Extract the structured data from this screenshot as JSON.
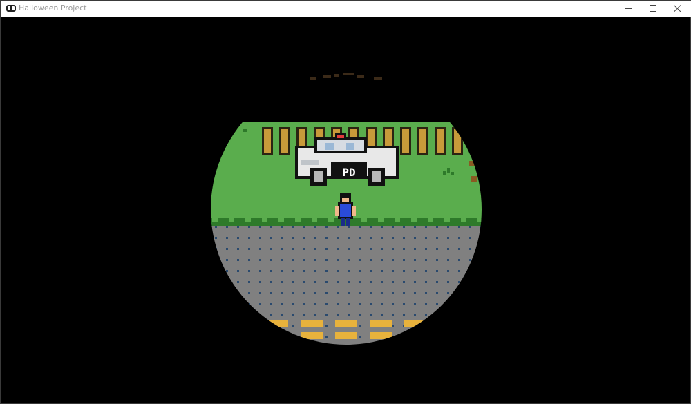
{
  "window": {
    "title": "Halloween Project",
    "app_icon": "gamepad-icon",
    "controls": [
      "minimize-icon",
      "maximize-icon",
      "close-icon"
    ]
  },
  "scene": {
    "vehicle_label": "PD",
    "colors": {
      "grass": "#5aad4d",
      "grass_dark": "#2e7a2a",
      "road": "#808080",
      "road_dots": "#2a4a6e",
      "lane_paint": "#e8b23c",
      "fence_post": "#c89a3a",
      "car_body": "#e8e8e8",
      "player_shirt": "#2a4bd8"
    }
  }
}
